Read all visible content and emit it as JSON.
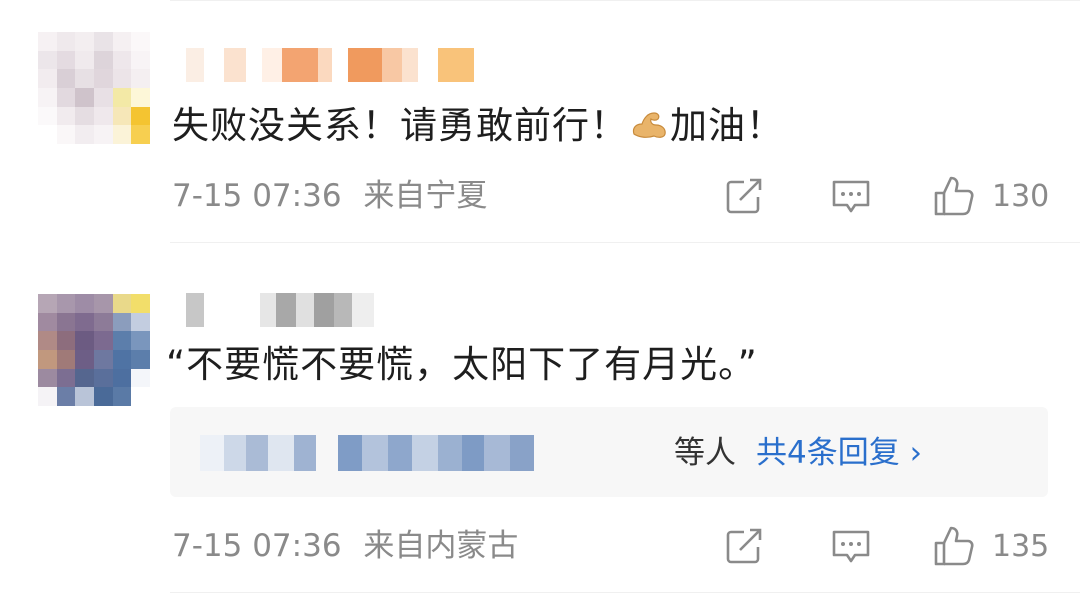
{
  "comments": [
    {
      "text_before": "失败没关系！请勇敢前行！",
      "text_after": "加油！",
      "emoji": "flexed-biceps",
      "timestamp": "7-15 07:36",
      "location": "来自宁夏",
      "likes": "130"
    },
    {
      "text": "“不要慌不要慌，太阳下了有月光。”",
      "reply_others": "等人",
      "reply_link": "共4条回复 ›",
      "timestamp": "7-15 07:36",
      "location": "来自内蒙古",
      "likes": "135"
    }
  ],
  "icons": {
    "share": "share-icon",
    "comment": "comment-icon",
    "like": "thumbs-up-icon"
  },
  "colors": {
    "link": "#2a6fcc",
    "meta": "#8a8a8a",
    "text": "#1e1e1e"
  }
}
